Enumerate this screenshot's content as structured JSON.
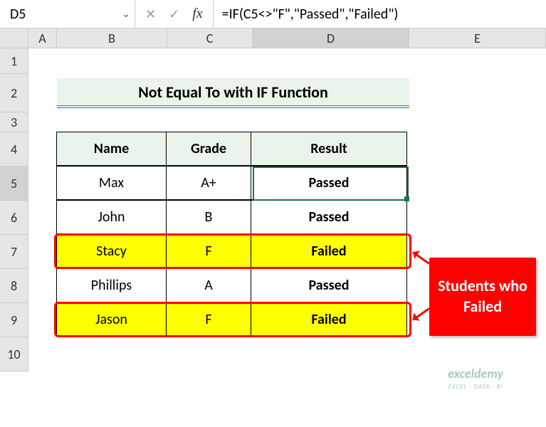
{
  "formulaBar": {
    "nameBox": "D5",
    "cancelIcon": "✕",
    "confirmIcon": "✓",
    "fx": "fx",
    "formula": "=IF(C5<>\"F\",\"Passed\",\"Failed\")"
  },
  "columns": {
    "A": "A",
    "B": "B",
    "C": "C",
    "D": "D",
    "E": "E"
  },
  "rows": {
    "1": "1",
    "2": "2",
    "3": "3",
    "4": "4",
    "5": "5",
    "6": "6",
    "7": "7",
    "8": "8",
    "9": "9",
    "10": "10"
  },
  "title": "Not Equal To with IF Function",
  "headers": {
    "name": "Name",
    "grade": "Grade",
    "result": "Result"
  },
  "chart_data": {
    "type": "table",
    "columns": [
      "Name",
      "Grade",
      "Result"
    ],
    "rows": [
      {
        "name": "Max",
        "grade": "A+",
        "result": "Passed",
        "highlight": false
      },
      {
        "name": "John",
        "grade": "B",
        "result": "Passed",
        "highlight": false
      },
      {
        "name": "Stacy",
        "grade": "F",
        "result": "Failed",
        "highlight": true
      },
      {
        "name": "Phillips",
        "grade": "A",
        "result": "Passed",
        "highlight": false
      },
      {
        "name": "Jason",
        "grade": "F",
        "result": "Failed",
        "highlight": true
      }
    ]
  },
  "callout": "Students who Failed",
  "watermark": {
    "big": "exceldemy",
    "small": "EXCEL · DATA · BI"
  }
}
